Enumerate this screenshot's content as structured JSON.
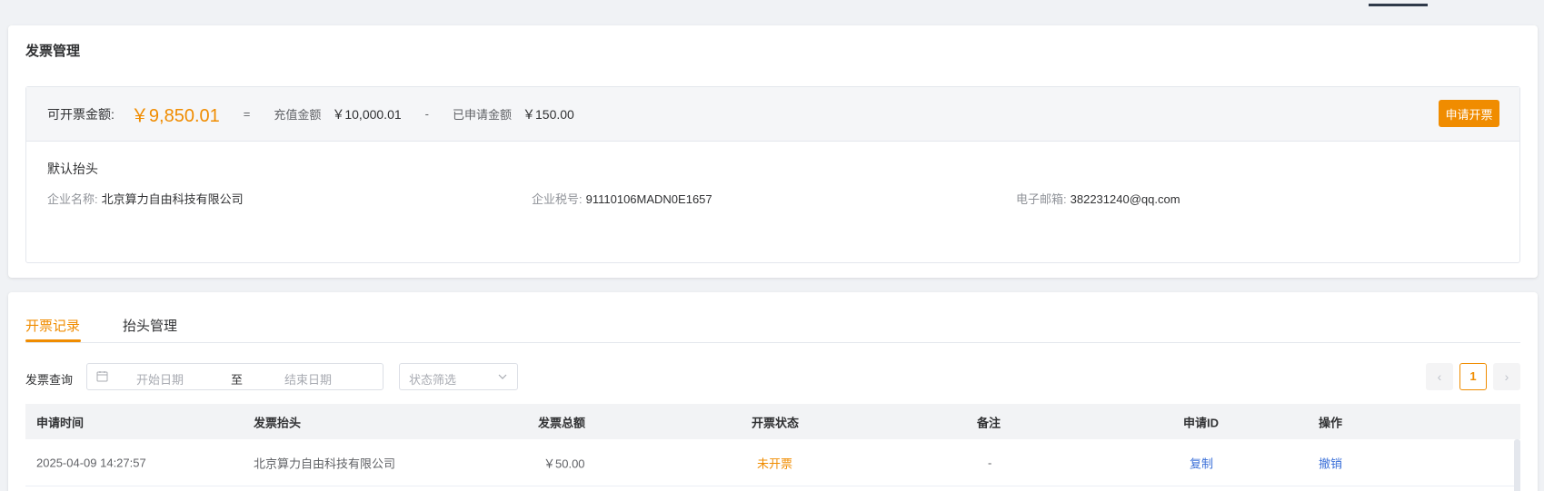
{
  "invoice_card": {
    "title": "发票管理",
    "available_label": "可开票金额:",
    "available_amount": "￥9,850.01",
    "equals": "=",
    "recharge_label": "充值金额",
    "recharge_amount": "￥10,000.01",
    "minus": "-",
    "applied_label": "已申请金额",
    "applied_amount": "￥150.00",
    "apply_button": "申请开票",
    "default_title": "默认抬头",
    "company_label": "企业名称:",
    "company_value": "北京算力自由科技有限公司",
    "tax_label": "企业税号:",
    "tax_value": "91110106MADN0E1657",
    "email_label": "电子邮箱:",
    "email_value": "382231240@qq.com"
  },
  "records": {
    "tabs": [
      "开票记录",
      "抬头管理"
    ],
    "active_tab": 0,
    "filter_label": "发票查询",
    "start_placeholder": "开始日期",
    "range_sep": "至",
    "end_placeholder": "结束日期",
    "status_placeholder": "状态筛选",
    "pager": {
      "prev": "‹",
      "page": "1",
      "next": "›"
    },
    "columns": [
      "申请时间",
      "发票抬头",
      "发票总额",
      "开票状态",
      "备注",
      "申请ID",
      "操作"
    ],
    "rows": [
      {
        "time": "2025-04-09 14:27:57",
        "title": "北京算力自由科技有限公司",
        "total": "￥50.00",
        "status": "未开票",
        "remark": "-",
        "id_action": "复制",
        "action": "撤销"
      }
    ]
  },
  "colors": {
    "accent": "#f08c00",
    "link": "#3a6fd8"
  }
}
